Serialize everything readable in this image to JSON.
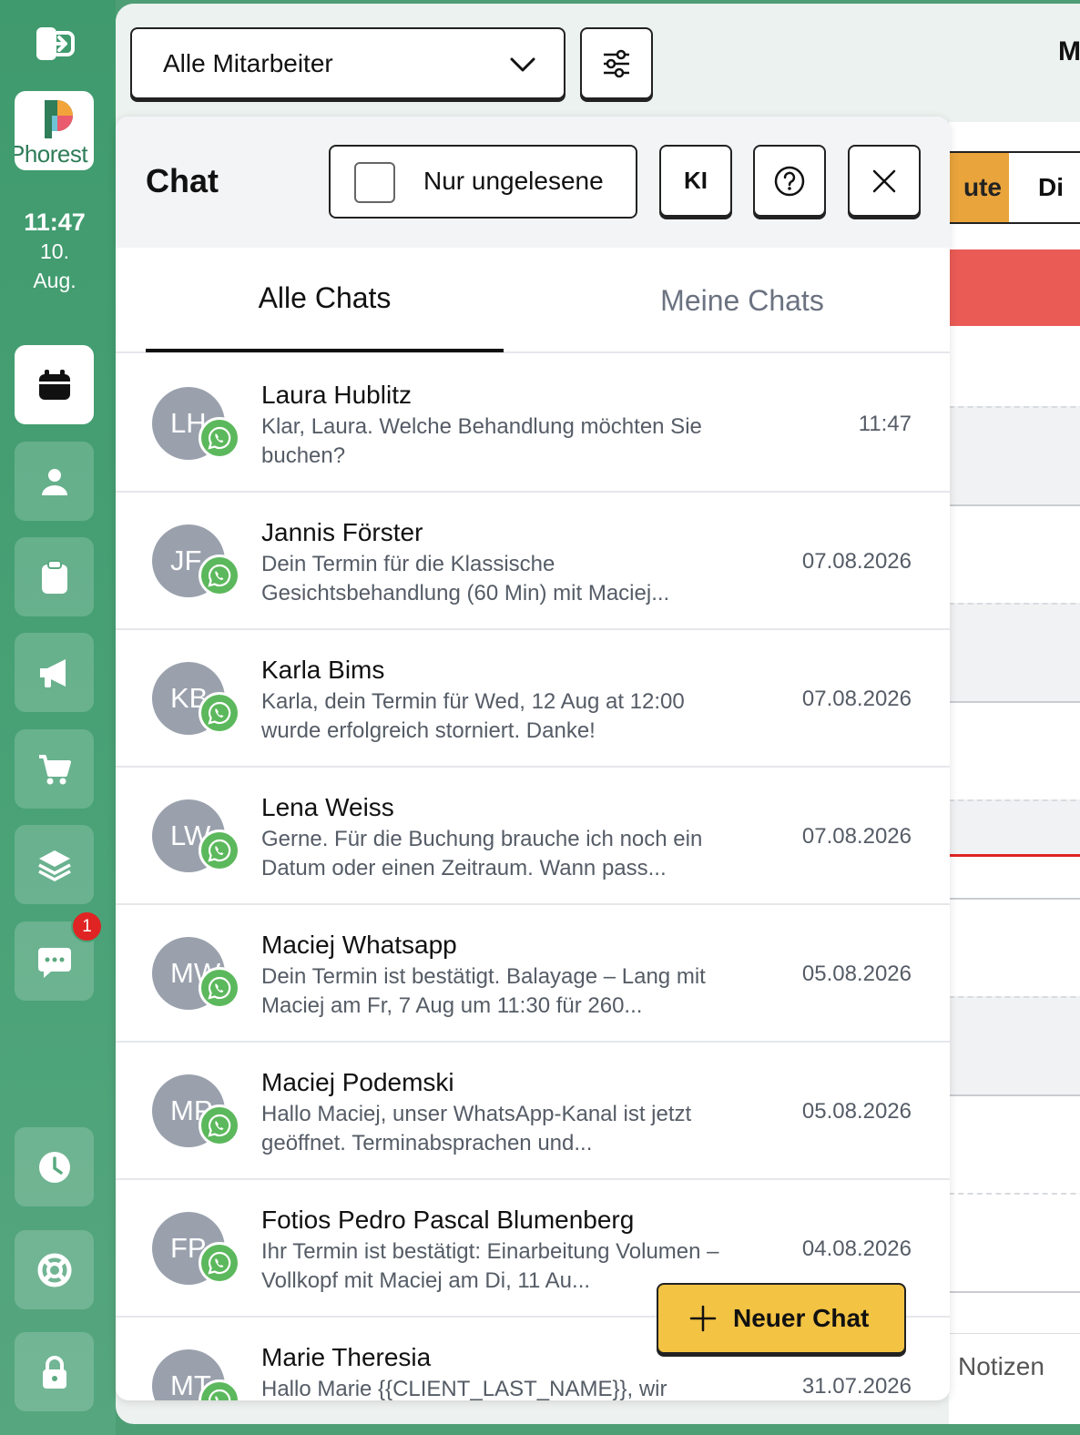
{
  "sidebar": {
    "logo_text": "Phorest",
    "time": "11:47",
    "date_day": "10.",
    "date_month": "Aug.",
    "chat_badge": "1",
    "nav_icons": [
      "calendar-icon",
      "client-icon",
      "clipboard-icon",
      "megaphone-icon",
      "cart-icon",
      "layers-icon",
      "chat-icon",
      "clock-icon",
      "lifebuoy-icon",
      "lock-icon"
    ]
  },
  "toolbar": {
    "staff_select": "Alle Mitarbeiter",
    "right_letter": "M"
  },
  "calendar": {
    "today_label": "ute",
    "day_label": "Di",
    "notes_label": "Notizen"
  },
  "chat": {
    "title": "Chat",
    "unread_label": "Nur ungelesene",
    "ai_label": "KI",
    "tabs": [
      {
        "label": "Alle Chats",
        "active": true
      },
      {
        "label": "Meine Chats",
        "active": false
      }
    ],
    "items": [
      {
        "initials": "LH",
        "name": "Laura Hublitz",
        "preview": "Klar, Laura. Welche Behandlung möchten Sie buchen?",
        "date": "11:47"
      },
      {
        "initials": "JF",
        "name": "Jannis Förster",
        "preview": "Dein Termin für die Klassische Gesichtsbehandlung (60 Min) mit Maciej...",
        "date": "07.08.2026"
      },
      {
        "initials": "KB",
        "name": "Karla Bims",
        "preview": "Karla, dein Termin für Wed, 12 Aug at 12:00 wurde erfolgreich storniert. Danke!",
        "date": "07.08.2026"
      },
      {
        "initials": "LW",
        "name": "Lena Weiss",
        "preview": "Gerne. Für die Buchung brauche ich noch ein Datum oder einen Zeitraum. Wann pass...",
        "date": "07.08.2026"
      },
      {
        "initials": "MW",
        "name": "Maciej Whatsapp",
        "preview": "Dein Termin ist bestätigt. Balayage – Lang mit Maciej am Fr, 7 Aug um 11:30 für 260...",
        "date": "05.08.2026"
      },
      {
        "initials": "MP",
        "name": "Maciej Podemski",
        "preview": "Hallo Maciej, unser WhatsApp-Kanal ist jetzt geöffnet. Terminabsprachen und...",
        "date": "05.08.2026"
      },
      {
        "initials": "FP",
        "name": "Fotios Pedro Pascal Blumenberg",
        "preview": "Ihr Termin ist bestätigt: Einarbeitung Volumen – Vollkopf mit Maciej am Di, 11 Au...",
        "date": "04.08.2026"
      },
      {
        "initials": "MT",
        "name": "Marie Theresia",
        "preview": "Hallo Marie {{CLIENT_LAST_NAME}}, wir",
        "date": "31.07.2026"
      }
    ],
    "new_chat_label": "Neuer Chat"
  }
}
